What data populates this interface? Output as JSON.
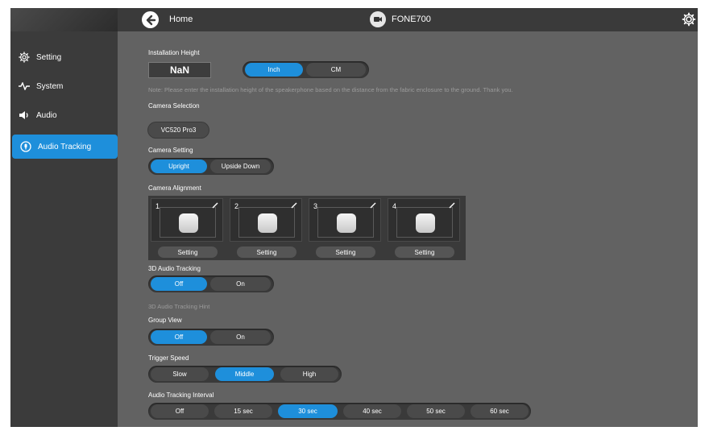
{
  "header": {
    "home_label": "Home",
    "device_name": "FONE700"
  },
  "sidebar": {
    "items": [
      {
        "label": "Setting",
        "icon": "gear-icon"
      },
      {
        "label": "System",
        "icon": "pulse-icon"
      },
      {
        "label": "Audio",
        "icon": "speaker-icon"
      },
      {
        "label": "Audio Tracking",
        "icon": "audio-tracking-icon",
        "active": true
      }
    ]
  },
  "installation": {
    "title": "Installation Height",
    "value": "NaN",
    "unit_options": [
      "Inch",
      "CM"
    ],
    "unit_selected": "Inch",
    "note": "Note: Please enter the installation height of the speakerphone based on the distance from the fabric enclosure to the ground. Thank you."
  },
  "camera_selection": {
    "title": "Camera Selection",
    "value": "VC520 Pro3"
  },
  "camera_setting": {
    "title": "Camera Setting",
    "options": [
      "Upright",
      "Upside Down"
    ],
    "selected": "Upright"
  },
  "camera_alignment": {
    "title": "Camera Alignment",
    "cards": [
      {
        "number": "1",
        "button": "Setting"
      },
      {
        "number": "2",
        "button": "Setting"
      },
      {
        "number": "3",
        "button": "Setting"
      },
      {
        "number": "4",
        "button": "Setting"
      }
    ]
  },
  "audio_tracking_3d": {
    "title": "3D Audio Tracking",
    "options": [
      "Off",
      "On"
    ],
    "selected": "Off",
    "hint": "3D Audio Tracking Hint"
  },
  "group_view": {
    "title": "Group View",
    "options": [
      "Off",
      "On"
    ],
    "selected": "Off"
  },
  "trigger_speed": {
    "title": "Trigger Speed",
    "options": [
      "Slow",
      "Middle",
      "High"
    ],
    "selected": "Middle"
  },
  "tracking_interval": {
    "title": "Audio Tracking Interval",
    "options": [
      "Off",
      "15 sec",
      "30 sec",
      "40 sec",
      "50 sec",
      "60 sec"
    ],
    "selected": "30 sec"
  },
  "colors": {
    "accent": "#1e8fdb",
    "panel": "#626262",
    "sidebar": "#3b3b3b"
  }
}
